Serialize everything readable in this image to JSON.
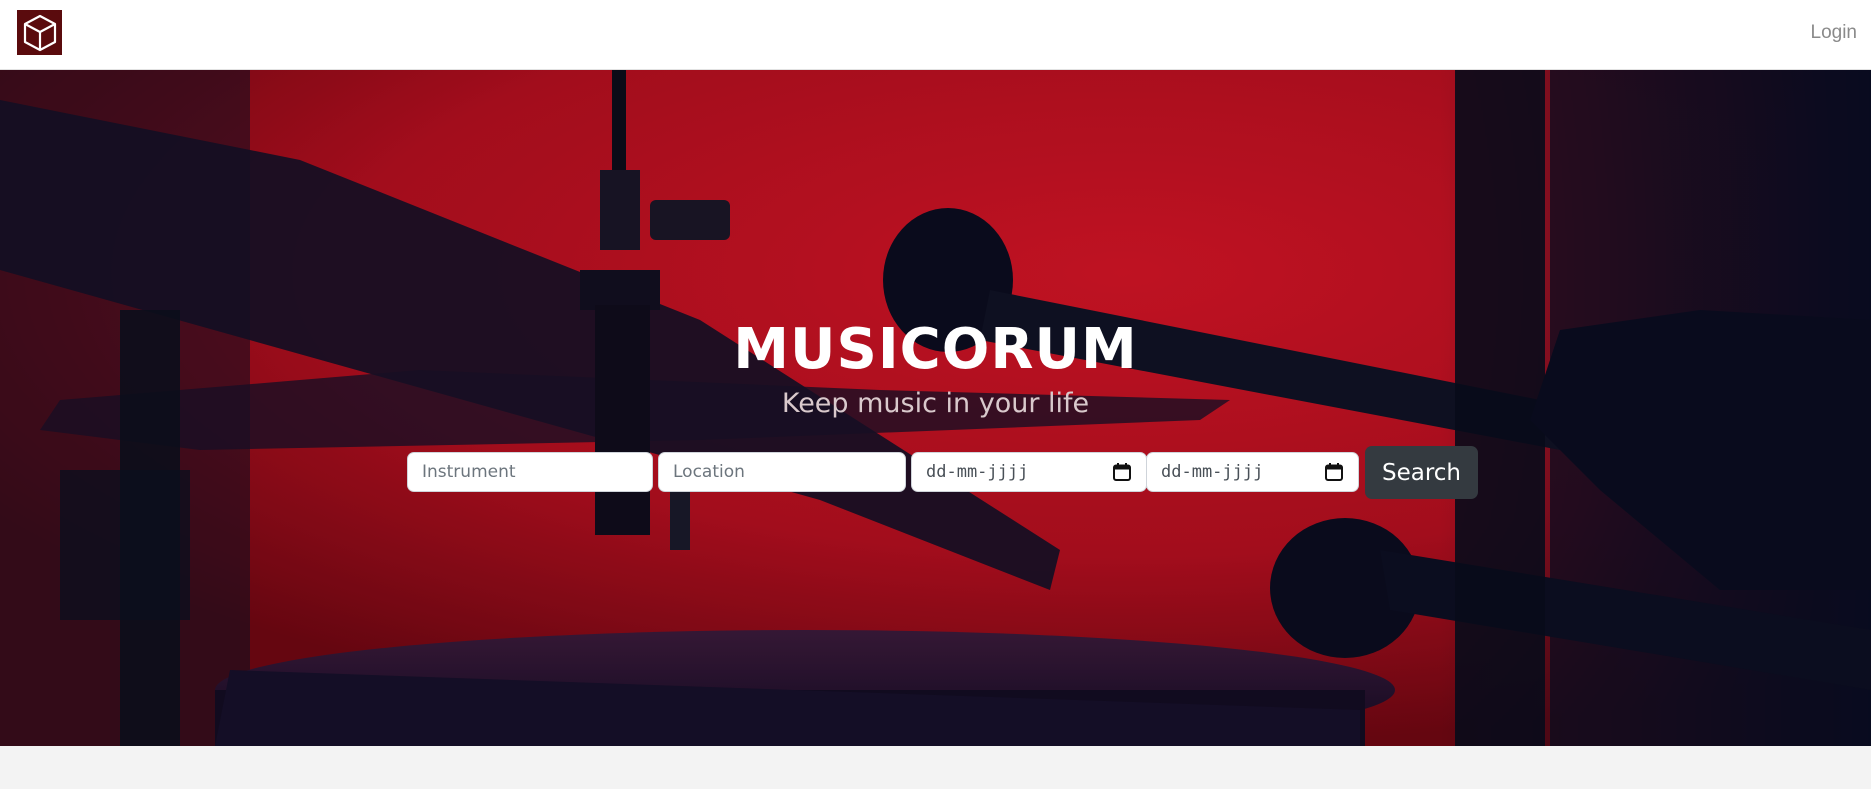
{
  "navbar": {
    "logo_icon": "cube-icon",
    "brand_color": "#5a0b0d",
    "login_label": "Login"
  },
  "hero": {
    "title": "MUSICORUM",
    "subtitle": "Keep music in your life",
    "background_color": "#b10f1e"
  },
  "search": {
    "instrument_placeholder": "Instrument",
    "location_placeholder": "Location",
    "start_date_placeholder": "dd-mm-jjjj",
    "end_date_placeholder": "dd-mm-jjjj",
    "calendar_icon": "calendar-icon",
    "button_label": "Search",
    "button_color": "#343a40"
  }
}
